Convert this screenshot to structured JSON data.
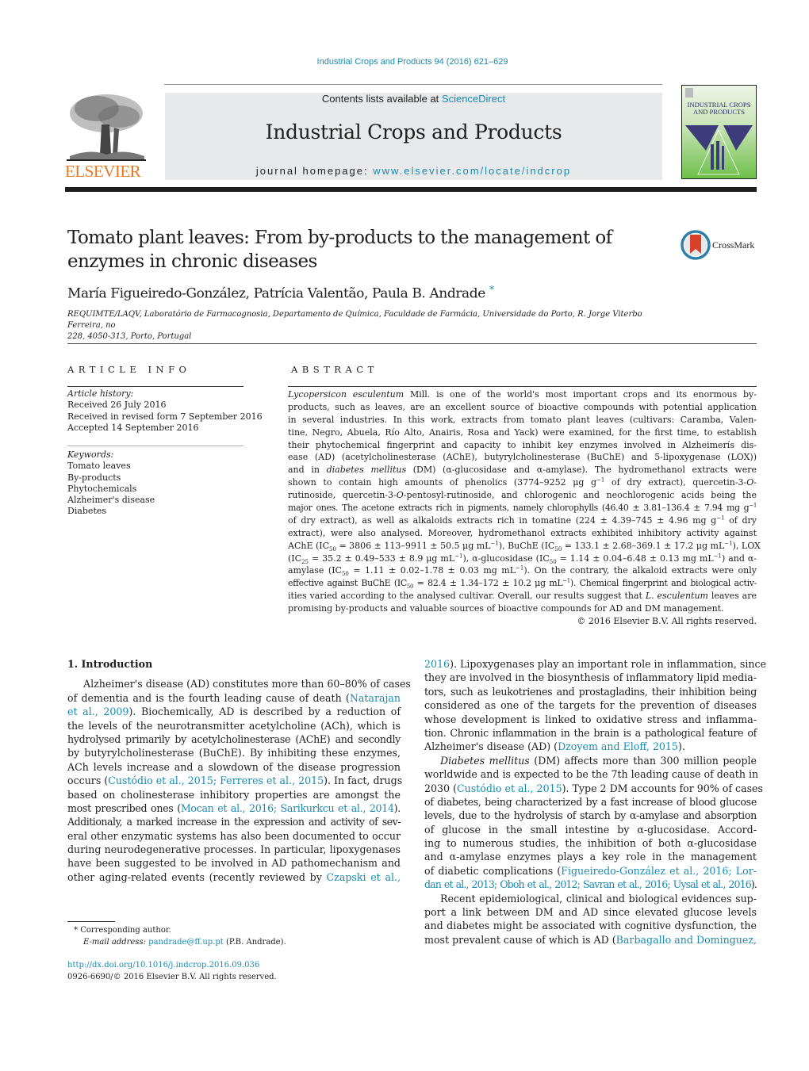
{
  "citation": "Industrial Crops and Products 94 (2016) 621–629",
  "header": {
    "publisher_word": "ELSEVIER",
    "contents_prefix": "Contents lists available at ",
    "contents_link": "ScienceDirect",
    "journal_name": "Industrial Crops and Products",
    "homepage_prefix": "journal homepage: ",
    "homepage_link": "www.elsevier.com/locate/indcrop",
    "cover_title": "INDUSTRIAL CROPS AND PRODUCTS"
  },
  "colors": {
    "link": "#1a8ab0",
    "elsevier_orange": "#e87722",
    "header_band": "#e8e9ea"
  },
  "article": {
    "title_line1": "Tomato plant leaves: From by-products to the management of",
    "title_line2": "enzymes in chronic diseases",
    "crossmark_label": "CrossMark",
    "authors": "María Figueiredo-González, Patrícia Valentão, Paula B. Andrade",
    "author_marker": "*",
    "affiliation_line1": "REQUIMTE/LAQV, Laboratório de Farmacognosia, Departamento de Química, Faculdade de Farmácia, Universidade do Porto, R. Jorge Viterbo Ferreira, no",
    "affiliation_line2": "228, 4050-313, Porto, Portugal"
  },
  "article_info": {
    "heading": "ARTICLE INFO",
    "history_label": "Article history:",
    "history": [
      "Received 26 July 2016",
      "Received in revised form 7 September 2016",
      "Accepted 14 September 2016"
    ],
    "keywords_label": "Keywords:",
    "keywords": [
      "Tomato leaves",
      "By-products",
      "Phytochemicals",
      "Alzheimer's disease",
      "Diabetes"
    ]
  },
  "abstract": {
    "heading": "ABSTRACT",
    "l1_it": "Lycopersicon esculentum",
    "l1": " Mill. is one of the world's most important crops and its enormous by-",
    "l2": "products, such as leaves, are an excellent source of bioactive compounds with potential application",
    "l3": "in several industries. In this work, extracts from tomato plant leaves (cultivars: Caramba, Valen-",
    "l4": "tine, Negro, Abuela, Río Alto, Anairis, Rosa and Yack) were examined, for the first time, to establish",
    "l5": "their phytochemical fingerprint and capacity to inhibit key enzymes involved in Alzheimerís dis-",
    "l6": "ease (AD) (acetylcholinesterase (AChE), butyrylcholinesterase (BuChE) and 5-lipoxygenase (LOX))",
    "l7a": "and in ",
    "l7_it": "diabetes mellitus",
    "l7b": " (DM) (α-glucosidase and α-amylase). The hydromethanol extracts were",
    "l8a": "shown to contain high amounts of phenolics (3774–9252 μg g",
    "l8_sup": "−1",
    "l8b": " of dry extract), quercetin-3-",
    "l8_it": "O",
    "l8c": "-",
    "l9a": "rutinoside, quercetin-3-",
    "l9_it": "O",
    "l9b": "-pentosyl-rutinoside, and chlorogenic and neochlorogenic acids being the",
    "l10a": "major ones. The acetone extracts rich in pigments, namely chlorophylls (46.40 ± 3.81–136.4 ± 7.94 mg g",
    "l10_sup": "−1",
    "l11a": "of dry extract), as well as alkaloids extracts rich in tomatine (224 ± 4.39–745 ± 4.96 mg g",
    "l11_sup": "−1",
    "l11b": " of dry",
    "l12": "extract), were also analysed. Moreover, hydromethanol extracts exhibited inhibitory activity against",
    "l13a": "AChE (IC",
    "l13_sub1": "50",
    "l13b": " = 3806 ± 113–9911 ± 50.5 μg mL",
    "l13_sup1": "−1",
    "l13c": "), BuChE (IC",
    "l13_sub2": "50",
    "l13d": " = 133.1 ± 2.68–369.1 ± 17.2 μg mL",
    "l13_sup2": "−1",
    "l13e": "), LOX",
    "l14a": "(IC",
    "l14_sub1": "25",
    "l14b": " = 35.2 ± 0.49–533 ± 8.9 μg mL",
    "l14_sup1": "−1",
    "l14c": "), α-glucosidase (IC",
    "l14_sub2": "50",
    "l14d": " = 1.14 ± 0.04–6.48 ± 0.13 mg mL",
    "l14_sup2": "−1",
    "l14e": ") and α-",
    "l15a": "amylase (IC",
    "l15_sub": "50",
    "l15b": " = 1.11 ± 0.02–1.78 ± 0.03 mg mL",
    "l15_sup": "−1",
    "l15c": "). On the contrary, the alkaloid extracts were only",
    "l16a": "effective against BuChE (IC",
    "l16_sub": "50",
    "l16b": " = 82.4 ± 1.34–172 ± 10.2 μg mL",
    "l16_sup": "−1",
    "l16c": "). Chemical fingerprint and biological activ-",
    "l17a": "ities varied according to the analysed cultivar. Overall, our results suggest that ",
    "l17_it": "L. esculentum",
    "l17b": " leaves are",
    "l18": "promising by-products and valuable sources of bioactive compounds for AD and DM management.",
    "copyright": "© 2016 Elsevier B.V. All rights reserved."
  },
  "intro": {
    "heading": "1. Introduction",
    "left": {
      "l1": "Alzheimer's disease (AD) constitutes more than 60–80% of cases",
      "l2a": "of dementia and is the fourth leading cause of death (",
      "l2_link": "Natarajan",
      "l3_link": "et al., 2009",
      "l3b": "). Biochemically, AD is described by a reduction of",
      "l4": "the levels of the neurotransmitter acetylcholine (ACh), which is",
      "l5": "hydrolysed primarily by acetylcholinesterase (AChE) and secondly",
      "l6": "by butyrylcholinesterase (BuChE). By inhibiting these enzymes,",
      "l7": "ACh levels increase and a slowdown of the disease progression",
      "l8a": "occurs (",
      "l8_link": "Custódio et al., 2015; Ferreres et al., 2015",
      "l8b": "). In fact, drugs",
      "l9": "based on cholinesterase inhibitory properties are amongst the",
      "l10a": "most prescribed ones (",
      "l10_link": "Mocan et al., 2016; Sarikurkcu et al., 2014",
      "l10b": ").",
      "l11": "Additionaly, a marked increase in the expression and activity of sev-",
      "l12": "eral other enzymatic systems has also been documented to occur",
      "l13": "during neurodegenerative processes. In particular, lipoxygenases",
      "l14": "have been suggested to be involved in AD pathomechanism and",
      "l15a": "other aging-related events (recently reviewed by ",
      "l15_link": "Czapski et al.,"
    },
    "right": {
      "r1_link": "2016",
      "r1b": "). Lipoxygenases play an important role in inflammation, since",
      "r2": "they are involved in the biosynthesis of inflammatory lipid media-",
      "r3": "tors, such as leukotrienes and prostagladins, their inhibition being",
      "r4": "considered as one of the targets for the prevention of diseases",
      "r5": "whose development is linked to oxidative stress and inflamma-",
      "r6": "tion. Chronic inflammation in the brain is a pathological feature of",
      "r7a": "Alzheimer's disease (AD) (",
      "r7_link": "Dzoyem and Eloff, 2015",
      "r7b": ").",
      "r8_it": "Diabetes mellitus",
      "r8b": " (DM) affects more than 300 million people",
      "r9": "worldwide and is expected to be the 7th leading cause of death in",
      "r10a": "2030 (",
      "r10_link": "Custódio et al., 2015",
      "r10b": "). Type 2 DM accounts for 90% of cases",
      "r11": "of diabetes, being characterized by a fast increase of blood glucose",
      "r12": "levels, due to the hydrolysis of starch by α-amylase and absorption",
      "r13": "of glucose in the small intestine by α-glucosidase. Accord-",
      "r14": "ing to numerous studies, the inhibition of both α-glucosidase",
      "r15": "and α-amylase enzymes plays a key role in the management",
      "r16a": "of diabetic complications (",
      "r16_link": "Figueiredo-González et al., 2016; Lor-",
      "r17_link": "dan et al., 2013; Oboh et al., 2012; Savran et al., 2016; Uysal et al., 2016",
      "r17b": ").",
      "r18": "Recent epidemiological, clinical and biological evidences sup-",
      "r19": "port a link between DM and AD since elevated glucose levels",
      "r20": "and diabetes might be associated with cognitive dysfunction, the",
      "r21a": "most prevalent cause of which is AD (",
      "r21_link": "Barbagallo and Dominguez,"
    }
  },
  "footnotes": {
    "marker": "*",
    "corresponding": "Corresponding author.",
    "email_label": "E-mail address:",
    "email": "pandrade@ff.up.pt",
    "email_suffix": " (P.B. Andrade).",
    "doi": "http://dx.doi.org/10.1016/j.indcrop.2016.09.036",
    "issn_copyright": "0926-6690/© 2016 Elsevier B.V. All rights reserved."
  }
}
